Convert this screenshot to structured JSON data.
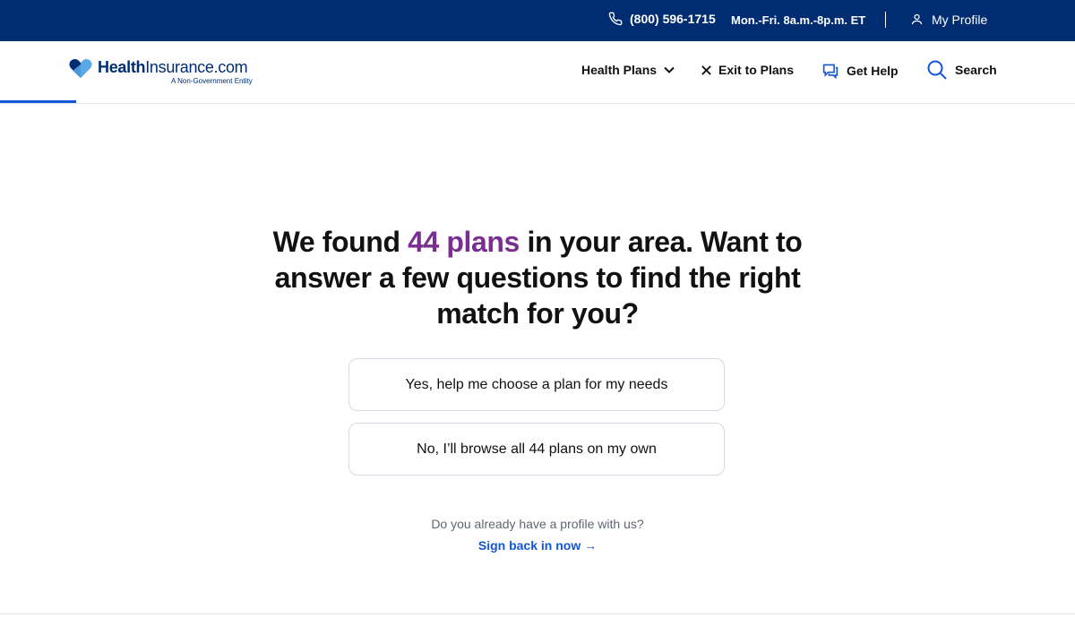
{
  "topbar": {
    "phone": "(800) 596-1715",
    "hours": "Mon.-Fri. 8a.m.-8p.m. ET",
    "profile_label": "My Profile"
  },
  "header": {
    "logo_brand_bold": "Health",
    "logo_brand_light": "Insurance.com",
    "logo_tagline": "A Non-Government Entity",
    "nav": {
      "plans": "Health Plans",
      "exit": "Exit to Plans",
      "help": "Get Help",
      "search": "Search"
    }
  },
  "main": {
    "headline_pre": "We found ",
    "headline_accent": "44 plans",
    "headline_post": " in your area. Want to answer a few questions to find the right match for you?",
    "choice_yes": "Yes, help me choose a plan for my needs",
    "choice_no": "No, I’ll browse all 44 plans on my own",
    "profile_question": "Do you already have a profile with us?",
    "signin_link": "Sign back in now →"
  },
  "colors": {
    "topbar_bg": "#002d72",
    "accent_purple": "#7b2e92",
    "link_blue": "#1456d8"
  }
}
